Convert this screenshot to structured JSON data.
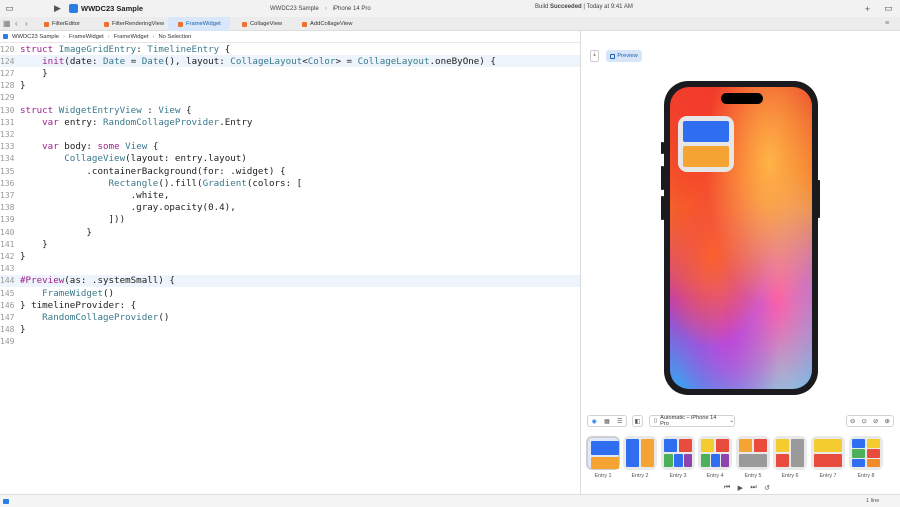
{
  "toolbar": {
    "app_name": "WWDC23 Sample",
    "scheme_target": "WWDC23 Sample",
    "scheme_device": "iPhone 14 Pro",
    "build_status_prefix": "Build",
    "build_status_bold": "Succeeded",
    "build_status_suffix": "| Today at 9:41 AM"
  },
  "tabs": [
    {
      "label": "FilterEditor",
      "active": false
    },
    {
      "label": "FilterRenderingView",
      "active": false
    },
    {
      "label": "FrameWidget",
      "active": true
    },
    {
      "label": "CollageView",
      "active": false
    },
    {
      "label": "AddCollageView",
      "active": false
    }
  ],
  "breadcrumb": {
    "items": [
      "WWDC23 Sample",
      "FrameWidget",
      "FrameWidget",
      "No Selection"
    ]
  },
  "editor": {
    "lines": [
      {
        "num": "120",
        "text": "struct ImageGridEntry: TimelineEntry {"
      },
      {
        "num": "124",
        "text": "    init(date: Date = Date(), layout: CollageLayout<Color> = CollageLayout.oneByOne) {"
      },
      {
        "num": "127",
        "text": "    }"
      },
      {
        "num": "128",
        "text": "}"
      },
      {
        "num": "129",
        "text": ""
      },
      {
        "num": "130",
        "text": "struct WidgetEntryView : View {"
      },
      {
        "num": "131",
        "text": "    var entry: RandomCollageProvider.Entry"
      },
      {
        "num": "132",
        "text": ""
      },
      {
        "num": "133",
        "text": "    var body: some View {"
      },
      {
        "num": "134",
        "text": "        CollageView(layout: entry.layout)"
      },
      {
        "num": "135",
        "text": "            .containerBackground(for: .widget) {"
      },
      {
        "num": "136",
        "text": "                Rectangle().fill(Gradient(colors: ["
      },
      {
        "num": "137",
        "text": "                    .white,"
      },
      {
        "num": "138",
        "text": "                    .gray.opacity(0.4),"
      },
      {
        "num": "139",
        "text": "                ]))"
      },
      {
        "num": "140",
        "text": "            }"
      },
      {
        "num": "141",
        "text": "    }"
      },
      {
        "num": "142",
        "text": "}"
      },
      {
        "num": "143",
        "text": ""
      },
      {
        "num": "144",
        "text": "#Preview(as: .systemSmall) {"
      },
      {
        "num": "145",
        "text": "    FrameWidget()"
      },
      {
        "num": "146",
        "text": "} timelineProvider: {"
      },
      {
        "num": "147",
        "text": "    RandomCollageProvider()"
      },
      {
        "num": "148",
        "text": "}"
      },
      {
        "num": "149",
        "text": ""
      }
    ]
  },
  "canvas": {
    "preview_label": "Preview",
    "device_label": "Automatic – iPhone 14 Pro"
  },
  "entries": [
    {
      "label": "Entry 1"
    },
    {
      "label": "Entry 2"
    },
    {
      "label": "Entry 3"
    },
    {
      "label": "Entry 4"
    },
    {
      "label": "Entry 5"
    },
    {
      "label": "Entry 6"
    },
    {
      "label": "Entry 7"
    },
    {
      "label": "Entry 8"
    }
  ],
  "status": {
    "line_info": "1 line"
  },
  "colors": {
    "accent": "#2a7de1",
    "widget_blue": "#2f6ef0",
    "widget_orange": "#f5a433",
    "keyword": "#a0208f"
  }
}
